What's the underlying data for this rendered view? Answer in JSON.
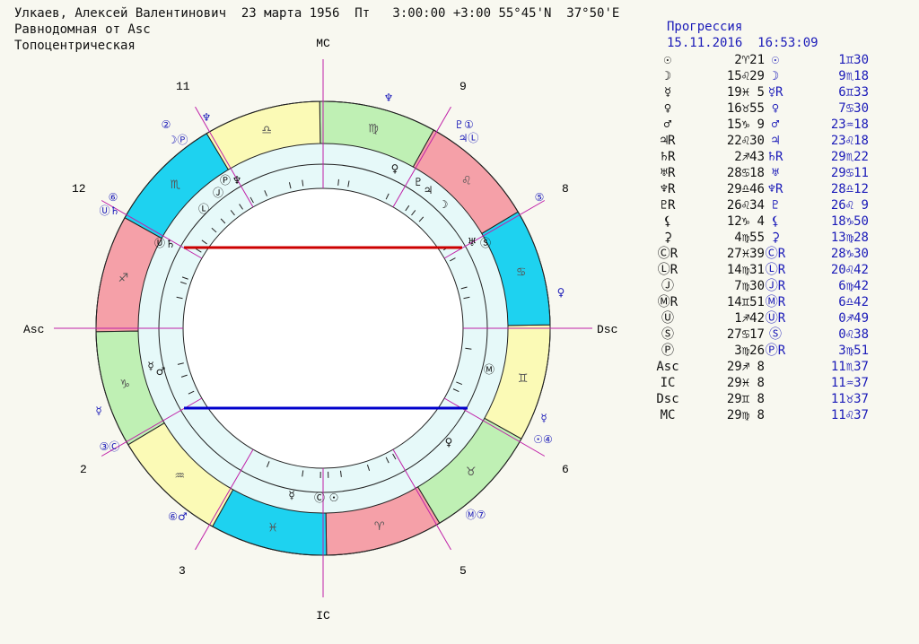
{
  "header": {
    "line1": "Улкаев, Алексей Валентинович  23 марта 1956  Пт   3:00:00 +3:00 55°45'N  37°50'E",
    "line2": "Равнодомная от Asc",
    "line3": "Топоцентрическая"
  },
  "progression": {
    "title": "Прогрессия",
    "date": "15.11.2016  16:53:09"
  },
  "natal_rows": [
    {
      "sym": "☉",
      "val": "2♈21"
    },
    {
      "sym": "☽",
      "val": "15♌29"
    },
    {
      "sym": "☿",
      "val": "19♓ 5"
    },
    {
      "sym": "♀",
      "val": "16♉55"
    },
    {
      "sym": "♂",
      "val": "15♑ 9"
    },
    {
      "sym": "♃R",
      "val": "22♌30"
    },
    {
      "sym": "♄R",
      "val": "2♐43"
    },
    {
      "sym": "♅R",
      "val": "28♋18"
    },
    {
      "sym": "♆R",
      "val": "29♎46"
    },
    {
      "sym": "♇R",
      "val": "26♌34"
    },
    {
      "sym": "⚸",
      "val": "12♑ 4"
    },
    {
      "sym": "⚳",
      "val": "4♍55"
    },
    {
      "sym": "ⒸR",
      "val": "27♓39"
    },
    {
      "sym": "ⓁR",
      "val": "14♍31"
    },
    {
      "sym": "Ⓙ",
      "val": "7♍30"
    },
    {
      "sym": "ⓂR",
      "val": "14♊51"
    },
    {
      "sym": "Ⓤ",
      "val": "1♐42"
    },
    {
      "sym": "Ⓢ",
      "val": "27♋17"
    },
    {
      "sym": "Ⓟ",
      "val": "3♍26"
    },
    {
      "sym": "Asc",
      "val": "29♐ 8"
    },
    {
      "sym": "IC",
      "val": "29♓ 8"
    },
    {
      "sym": "Dsc",
      "val": "29♊ 8"
    },
    {
      "sym": "MC",
      "val": "29♍ 8"
    }
  ],
  "prog_rows": [
    {
      "sym": "☉",
      "val": "1♊30"
    },
    {
      "sym": "☽",
      "val": "9♏18"
    },
    {
      "sym": "☿R",
      "val": "6♊33"
    },
    {
      "sym": "♀",
      "val": "7♋30"
    },
    {
      "sym": "♂",
      "val": "23♒18"
    },
    {
      "sym": "♃",
      "val": "23♌18"
    },
    {
      "sym": "♄R",
      "val": "29♏22"
    },
    {
      "sym": "♅",
      "val": "29♋11"
    },
    {
      "sym": "♆R",
      "val": "28♎12"
    },
    {
      "sym": "♇",
      "val": "26♌ 9"
    },
    {
      "sym": "⚸",
      "val": "18♑50"
    },
    {
      "sym": "⚳",
      "val": "13♍28"
    },
    {
      "sym": "ⒸR",
      "val": "28♑30"
    },
    {
      "sym": "ⓁR",
      "val": "20♌42"
    },
    {
      "sym": "ⒿR",
      "val": "6♍42"
    },
    {
      "sym": "ⓂR",
      "val": "6♎42"
    },
    {
      "sym": "ⓊR",
      "val": "0♐49"
    },
    {
      "sym": "Ⓢ",
      "val": "0♌38"
    },
    {
      "sym": "ⓅR",
      "val": "3♍51"
    },
    {
      "sym": "",
      "val": "11♏37"
    },
    {
      "sym": "",
      "val": "11♒37"
    },
    {
      "sym": "",
      "val": "11♉37"
    },
    {
      "sym": "",
      "val": "11♌37"
    }
  ],
  "axes": {
    "mc": "MC",
    "ic": "IC",
    "asc": "Asc",
    "dsc": "Dsc"
  },
  "house_numbers": [
    "2",
    "3",
    "5",
    "6",
    "8",
    "9",
    "11",
    "12"
  ],
  "zodiac_signs": [
    "♈",
    "♉",
    "♊",
    "♋",
    "♌",
    "♍",
    "♎",
    "♏",
    "♐",
    "♑",
    "♒",
    "♓"
  ],
  "sign_colors": {
    "fire": "#f5a0a8",
    "earth": "#bff0b4",
    "air": "#fbfab6",
    "water": "#1ed2f0"
  },
  "outer_planets": [
    "♀",
    "☿",
    "☉④",
    "Ⓜ⑦",
    "⑥♂",
    "☿",
    "③Ⓒ",
    "⑥",
    "Ⓤ♄",
    "②",
    "☽Ⓟ",
    "♆",
    "♇①",
    "♃Ⓛ",
    "⑤",
    "♆"
  ],
  "inner_planets": [
    "♀",
    "Ⓜ",
    "☿",
    "Ⓒ",
    "☉",
    "☿",
    "♂",
    "♄",
    "Ⓤ",
    "Ⓛ",
    "Ⓙ",
    "Ⓟ",
    "♆",
    "♀",
    "♇",
    "♃",
    "☽",
    "♅",
    "Ⓢ"
  ],
  "aspect_colors": {
    "red": "#cc0000",
    "blue": "#0000cc"
  },
  "accent": "#c020a8"
}
